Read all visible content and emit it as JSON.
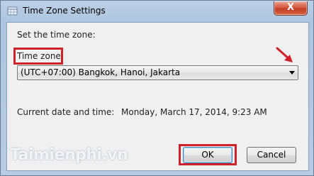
{
  "window": {
    "title": "Time Zone Settings",
    "close_label": "X"
  },
  "dialog": {
    "instruction": "Set the time zone:",
    "timezone_label": "Time zone:",
    "timezone_value": "(UTC+07:00) Bangkok, Hanoi, Jakarta",
    "current_label": "Current date and time:",
    "current_value": "Monday, March 17, 2014, 9:23 AM"
  },
  "buttons": {
    "ok": "OK",
    "cancel": "Cancel"
  },
  "watermark": "Taimienphi.vn",
  "colors": {
    "highlight": "#d0212b",
    "accent": "#3c7fb1"
  }
}
